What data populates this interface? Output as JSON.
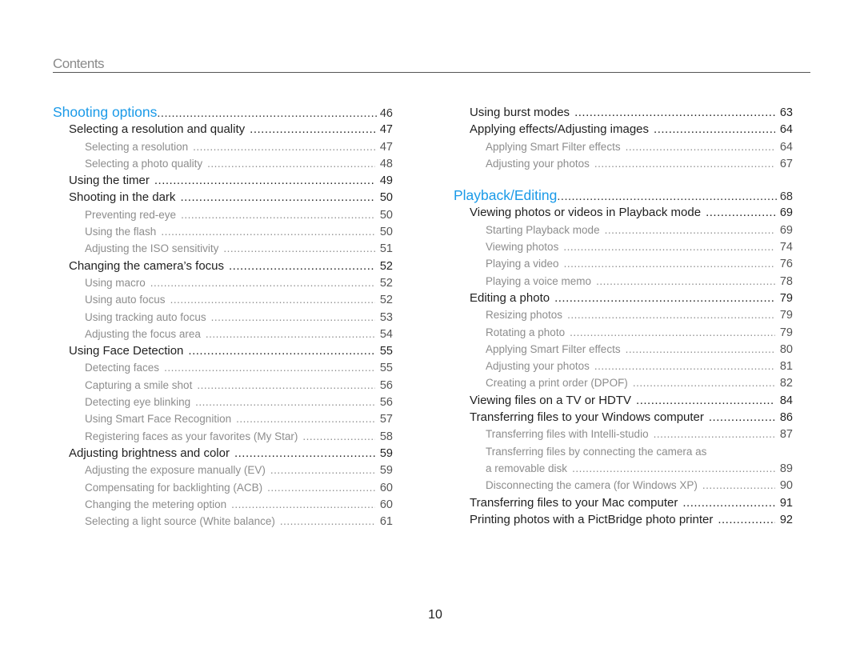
{
  "header": {
    "title": "Contents"
  },
  "page_number": "10",
  "left_column": [
    {
      "level": 0,
      "text": "Shooting options",
      "page": "46"
    },
    {
      "level": 1,
      "text": "Selecting a resolution and quality",
      "page": "47"
    },
    {
      "level": 2,
      "text": "Selecting a resolution",
      "page": "47"
    },
    {
      "level": 2,
      "text": "Selecting a photo quality",
      "page": "48"
    },
    {
      "level": 1,
      "text": "Using the timer",
      "page": "49"
    },
    {
      "level": 1,
      "text": "Shooting in the dark",
      "page": "50"
    },
    {
      "level": 2,
      "text": "Preventing red-eye",
      "page": "50"
    },
    {
      "level": 2,
      "text": "Using the flash",
      "page": "50"
    },
    {
      "level": 2,
      "text": "Adjusting the ISO sensitivity",
      "page": "51"
    },
    {
      "level": 1,
      "text": "Changing the camera’s focus",
      "page": "52"
    },
    {
      "level": 2,
      "text": "Using macro",
      "page": "52"
    },
    {
      "level": 2,
      "text": "Using auto focus",
      "page": "52"
    },
    {
      "level": 2,
      "text": "Using tracking auto focus",
      "page": "53"
    },
    {
      "level": 2,
      "text": "Adjusting the focus area",
      "page": "54"
    },
    {
      "level": 1,
      "text": "Using Face Detection",
      "page": "55"
    },
    {
      "level": 2,
      "text": "Detecting faces",
      "page": "55"
    },
    {
      "level": 2,
      "text": "Capturing a smile shot",
      "page": "56"
    },
    {
      "level": 2,
      "text": "Detecting eye blinking",
      "page": "56"
    },
    {
      "level": 2,
      "text": "Using Smart Face Recognition",
      "page": "57"
    },
    {
      "level": 2,
      "text": "Registering faces as your favorites (My Star)",
      "page": "58"
    },
    {
      "level": 1,
      "text": "Adjusting brightness and color",
      "page": "59"
    },
    {
      "level": 2,
      "text": "Adjusting the exposure manually (EV)",
      "page": "59"
    },
    {
      "level": 2,
      "text": "Compensating for backlighting (ACB)",
      "page": "60"
    },
    {
      "level": 2,
      "text": "Changing the metering option",
      "page": "60"
    },
    {
      "level": 2,
      "text": "Selecting a light source (White balance)",
      "page": "61"
    }
  ],
  "right_column": [
    {
      "level": 1,
      "text": "Using burst modes",
      "page": "63"
    },
    {
      "level": 1,
      "text": "Applying effects/Adjusting images",
      "page": "64"
    },
    {
      "level": 2,
      "text": "Applying Smart Filter effects",
      "page": "64"
    },
    {
      "level": 2,
      "text": "Adjusting your photos",
      "page": "67"
    },
    {
      "level": 0,
      "text": "Playback/Editing",
      "page": "68"
    },
    {
      "level": 1,
      "text": "Viewing photos or videos in Playback mode",
      "page": "69"
    },
    {
      "level": 2,
      "text": "Starting Playback mode",
      "page": "69"
    },
    {
      "level": 2,
      "text": "Viewing photos",
      "page": "74"
    },
    {
      "level": 2,
      "text": "Playing a video",
      "page": "76"
    },
    {
      "level": 2,
      "text": "Playing a voice memo",
      "page": "78"
    },
    {
      "level": 1,
      "text": "Editing a photo",
      "page": "79"
    },
    {
      "level": 2,
      "text": "Resizing photos",
      "page": "79"
    },
    {
      "level": 2,
      "text": "Rotating a photo",
      "page": "79"
    },
    {
      "level": 2,
      "text": "Applying Smart Filter effects",
      "page": "80"
    },
    {
      "level": 2,
      "text": "Adjusting your photos",
      "page": "81"
    },
    {
      "level": 2,
      "text": "Creating a print order (DPOF)",
      "page": "82"
    },
    {
      "level": 1,
      "text": "Viewing files on a TV or HDTV",
      "page": "84"
    },
    {
      "level": 1,
      "text": "Transferring files to your Windows computer",
      "page": "86"
    },
    {
      "level": 2,
      "text": "Transferring files with Intelli-studio",
      "page": "87"
    },
    {
      "level": 2,
      "text": "Transferring files by connecting the camera as",
      "text_cont": "a removable disk",
      "page": "89"
    },
    {
      "level": 2,
      "text": "Disconnecting the camera (for Windows XP)",
      "page": "90"
    },
    {
      "level": 1,
      "text": "Transferring files to your Mac computer",
      "page": "91"
    },
    {
      "level": 1,
      "text": "Printing photos with a PictBridge photo printer",
      "page": "92"
    }
  ],
  "colors": {
    "section_heading": "#1a9ae8",
    "entry": "#222222",
    "subentry": "#8d8d8d",
    "rule": "#555555"
  }
}
